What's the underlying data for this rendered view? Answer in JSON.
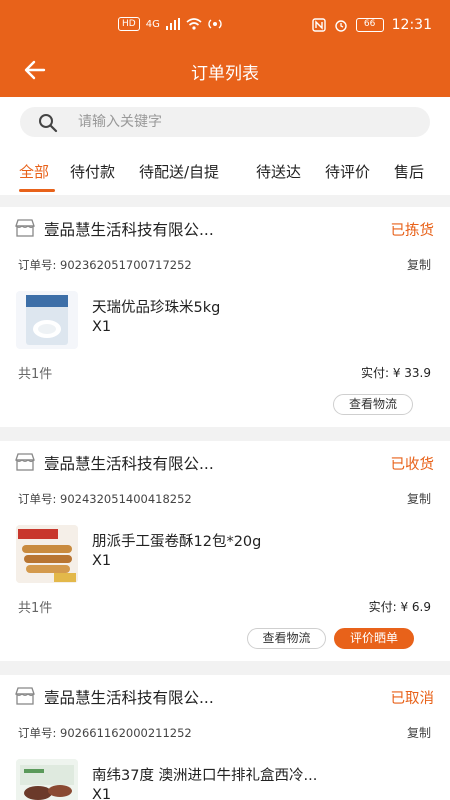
{
  "status_bar": {
    "net_label": "HD",
    "signal": "4G",
    "battery": "66",
    "time": "12:31"
  },
  "header": {
    "title": "订单列表",
    "back_icon": "arrow-left-icon"
  },
  "search": {
    "placeholder": "请输入关键字"
  },
  "tabs": [
    {
      "label": "全部",
      "active": true
    },
    {
      "label": "待付款"
    },
    {
      "label": "待配送/自提"
    },
    {
      "label": "待送达"
    },
    {
      "label": "待评价"
    },
    {
      "label": "售后"
    }
  ],
  "orders": [
    {
      "store": "壹品慧生活科技有限公...",
      "status": "已拣货",
      "order_no_label": "订单号:",
      "order_no": "902362051700717252",
      "copy_label": "复制",
      "product_name": "天瑞优品珍珠米5kg",
      "quantity": "X1",
      "item_count": "共1件",
      "paid_label": "实付:",
      "paid_amount": "¥ 33.9",
      "buttons": [
        "查看物流"
      ]
    },
    {
      "store": "壹品慧生活科技有限公...",
      "status": "已收货",
      "order_no_label": "订单号:",
      "order_no": "902432051400418252",
      "copy_label": "复制",
      "product_name": "朋派手工蛋卷酥12包*20g",
      "quantity": "X1",
      "item_count": "共1件",
      "paid_label": "实付:",
      "paid_amount": "¥ 6.9",
      "buttons": [
        "查看物流",
        "评价晒单"
      ]
    },
    {
      "store": "壹品慧生活科技有限公...",
      "status": "已取消",
      "order_no_label": "订单号:",
      "order_no": "902661162000211252",
      "copy_label": "复制",
      "product_name": "南纬37度 澳洲进口牛排礼盒西冷...",
      "quantity": "X1"
    }
  ],
  "colors": {
    "accent": "#e8621a"
  }
}
